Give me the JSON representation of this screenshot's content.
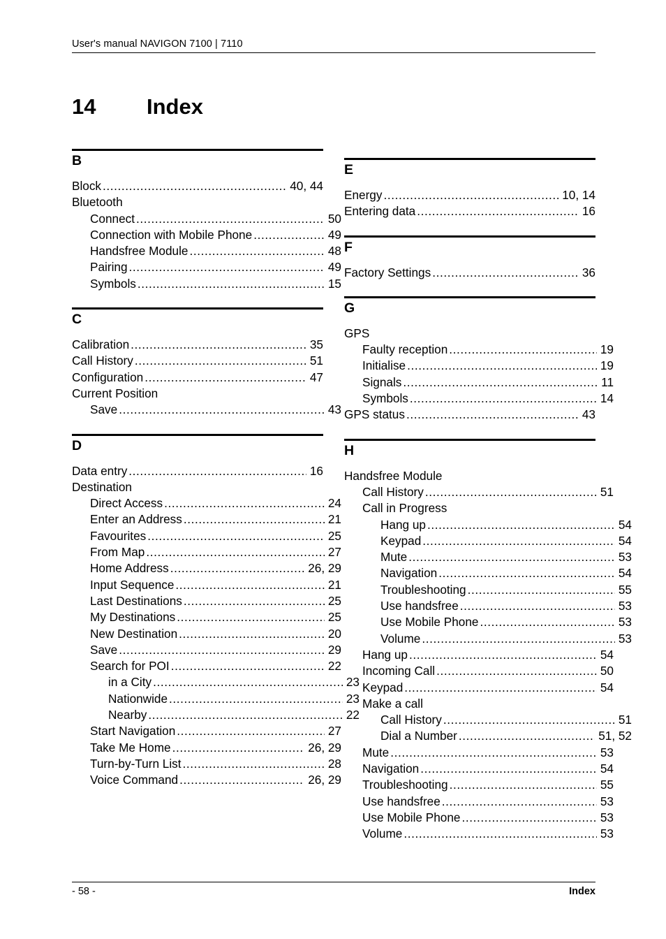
{
  "header": {
    "text": "User's manual NAVIGON 7100 | 7110"
  },
  "title": {
    "number": "14",
    "label": "Index"
  },
  "footer": {
    "page_label": "- 58 -",
    "section_label": "Index"
  },
  "columns": [
    {
      "name": "left-column",
      "sections": [
        {
          "letter": "B",
          "entries": [
            {
              "label": "Block",
              "page": "40, 44",
              "level": 0
            },
            {
              "label": "Bluetooth",
              "page": "",
              "level": 0
            },
            {
              "label": "Connect",
              "page": "50",
              "level": 1
            },
            {
              "label": "Connection with Mobile Phone",
              "page": "49",
              "level": 1
            },
            {
              "label": "Handsfree Module",
              "page": "48",
              "level": 1
            },
            {
              "label": "Pairing",
              "page": "49",
              "level": 1
            },
            {
              "label": "Symbols",
              "page": "15",
              "level": 1
            }
          ]
        },
        {
          "letter": "C",
          "entries": [
            {
              "label": "Calibration",
              "page": "35",
              "level": 0
            },
            {
              "label": "Call History",
              "page": "51",
              "level": 0
            },
            {
              "label": "Configuration",
              "page": "47",
              "level": 0
            },
            {
              "label": "Current Position",
              "page": "",
              "level": 0
            },
            {
              "label": "Save",
              "page": "43",
              "level": 1
            }
          ]
        },
        {
          "letter": "D",
          "entries": [
            {
              "label": "Data entry",
              "page": "16",
              "level": 0
            },
            {
              "label": "Destination",
              "page": "",
              "level": 0
            },
            {
              "label": "Direct Access",
              "page": "24",
              "level": 1
            },
            {
              "label": "Enter an Address",
              "page": "21",
              "level": 1
            },
            {
              "label": "Favourites",
              "page": "25",
              "level": 1
            },
            {
              "label": "From Map",
              "page": "27",
              "level": 1
            },
            {
              "label": "Home Address",
              "page": "26, 29",
              "level": 1
            },
            {
              "label": "Input Sequence",
              "page": "21",
              "level": 1
            },
            {
              "label": "Last Destinations",
              "page": "25",
              "level": 1
            },
            {
              "label": "My Destinations",
              "page": "25",
              "level": 1
            },
            {
              "label": "New Destination",
              "page": "20",
              "level": 1
            },
            {
              "label": "Save",
              "page": "29",
              "level": 1
            },
            {
              "label": "Search for POI",
              "page": "22",
              "level": 1
            },
            {
              "label": "in a City",
              "page": "23",
              "level": 2
            },
            {
              "label": "Nationwide",
              "page": "23",
              "level": 2
            },
            {
              "label": "Nearby",
              "page": "22",
              "level": 2
            },
            {
              "label": "Start Navigation",
              "page": "27",
              "level": 1
            },
            {
              "label": "Take Me Home",
              "page": "26, 29",
              "level": 1
            },
            {
              "label": "Turn-by-Turn List",
              "page": "28",
              "level": 1
            },
            {
              "label": "Voice Command",
              "page": "26, 29",
              "level": 1
            }
          ]
        }
      ]
    },
    {
      "name": "right-column",
      "sections": [
        {
          "letter": "E",
          "entries": [
            {
              "label": "Energy",
              "page": "10, 14",
              "level": 0
            },
            {
              "label": "Entering data",
              "page": "16",
              "level": 0
            }
          ]
        },
        {
          "letter": "F",
          "entries": [
            {
              "label": "Factory Settings",
              "page": "36",
              "level": 0
            }
          ]
        },
        {
          "letter": "G",
          "entries": [
            {
              "label": "GPS",
              "page": "",
              "level": 0
            },
            {
              "label": "Faulty reception",
              "page": "19",
              "level": 1
            },
            {
              "label": "Initialise",
              "page": "19",
              "level": 1
            },
            {
              "label": "Signals",
              "page": "11",
              "level": 1
            },
            {
              "label": "Symbols",
              "page": "14",
              "level": 1
            },
            {
              "label": "GPS status",
              "page": "43",
              "level": 0
            }
          ]
        },
        {
          "letter": "H",
          "entries": [
            {
              "label": "Handsfree Module",
              "page": "",
              "level": 0
            },
            {
              "label": "Call History",
              "page": "51",
              "level": 1
            },
            {
              "label": "Call in Progress",
              "page": "",
              "level": 1
            },
            {
              "label": "Hang up",
              "page": "54",
              "level": 2
            },
            {
              "label": "Keypad",
              "page": "54",
              "level": 2
            },
            {
              "label": "Mute",
              "page": "53",
              "level": 2
            },
            {
              "label": "Navigation",
              "page": "54",
              "level": 2
            },
            {
              "label": "Troubleshooting",
              "page": "55",
              "level": 2
            },
            {
              "label": "Use handsfree",
              "page": "53",
              "level": 2
            },
            {
              "label": "Use Mobile Phone",
              "page": "53",
              "level": 2
            },
            {
              "label": "Volume",
              "page": "53",
              "level": 2
            },
            {
              "label": "Hang up",
              "page": "54",
              "level": 1
            },
            {
              "label": "Incoming Call",
              "page": "50",
              "level": 1
            },
            {
              "label": "Keypad",
              "page": "54",
              "level": 1
            },
            {
              "label": "Make a call",
              "page": "",
              "level": 1
            },
            {
              "label": "Call History",
              "page": "51",
              "level": 2
            },
            {
              "label": "Dial a Number",
              "page": "51, 52",
              "level": 2
            },
            {
              "label": "Mute",
              "page": "53",
              "level": 1
            },
            {
              "label": "Navigation",
              "page": "54",
              "level": 1
            },
            {
              "label": "Troubleshooting",
              "page": "55",
              "level": 1
            },
            {
              "label": "Use handsfree",
              "page": "53",
              "level": 1
            },
            {
              "label": "Use Mobile Phone",
              "page": "53",
              "level": 1
            },
            {
              "label": "Volume",
              "page": "53",
              "level": 1
            }
          ]
        }
      ]
    }
  ]
}
